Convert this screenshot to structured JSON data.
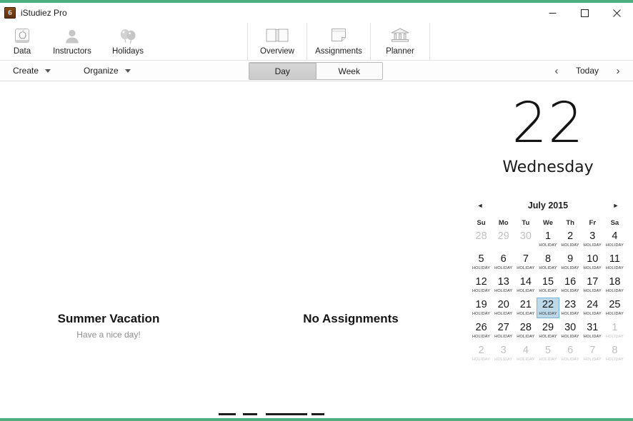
{
  "window": {
    "title": "iStudiez Pro",
    "app_icon": "istudiez-app-icon",
    "accent_color": "#4caf7d",
    "controls": {
      "minimize": "minimize-icon",
      "maximize": "maximize-icon",
      "close": "close-icon"
    }
  },
  "ribbon": {
    "left_group": [
      {
        "label": "Data",
        "icon": "database-apple-icon"
      },
      {
        "label": "Instructors",
        "icon": "person-icon"
      },
      {
        "label": "Holidays",
        "icon": "balloons-icon"
      }
    ],
    "center_group": [
      {
        "label": "Overview",
        "icon": "open-book-icon"
      },
      {
        "label": "Assignments",
        "icon": "note-page-icon"
      },
      {
        "label": "Planner",
        "icon": "bank-columns-icon"
      }
    ]
  },
  "subbar": {
    "menus": [
      {
        "label": "Create",
        "icon": "chevron-down-icon"
      },
      {
        "label": "Organize",
        "icon": "chevron-down-icon"
      }
    ],
    "view_toggle": {
      "options": [
        "Day",
        "Week"
      ],
      "selected": "Day"
    },
    "navigation": {
      "prev": "‹",
      "today_label": "Today",
      "next": "›"
    }
  },
  "main": {
    "holiday_panel": {
      "title": "Summer Vacation",
      "subtitle": "Have a nice day!"
    },
    "assignments_panel": {
      "title": "No Assignments"
    }
  },
  "date_panel": {
    "day_number": "22",
    "day_name": "Wednesday"
  },
  "mini_calendar": {
    "month_label": "July 2015",
    "prev_icon": "◄",
    "next_icon": "►",
    "weekdays": [
      "Su",
      "Mo",
      "Tu",
      "We",
      "Th",
      "Fr",
      "Sa"
    ],
    "holiday_label": "HOLIDAY",
    "selected_day": 22,
    "selected_color": "#bcd9ea",
    "weeks": [
      [
        {
          "n": "28",
          "out": true,
          "holiday": false
        },
        {
          "n": "29",
          "out": true,
          "holiday": false
        },
        {
          "n": "30",
          "out": true,
          "holiday": false
        },
        {
          "n": "1",
          "out": false,
          "holiday": true
        },
        {
          "n": "2",
          "out": false,
          "holiday": true
        },
        {
          "n": "3",
          "out": false,
          "holiday": true
        },
        {
          "n": "4",
          "out": false,
          "holiday": true
        }
      ],
      [
        {
          "n": "5",
          "out": false,
          "holiday": true
        },
        {
          "n": "6",
          "out": false,
          "holiday": true
        },
        {
          "n": "7",
          "out": false,
          "holiday": true
        },
        {
          "n": "8",
          "out": false,
          "holiday": true
        },
        {
          "n": "9",
          "out": false,
          "holiday": true
        },
        {
          "n": "10",
          "out": false,
          "holiday": true
        },
        {
          "n": "11",
          "out": false,
          "holiday": true
        }
      ],
      [
        {
          "n": "12",
          "out": false,
          "holiday": true
        },
        {
          "n": "13",
          "out": false,
          "holiday": true
        },
        {
          "n": "14",
          "out": false,
          "holiday": true
        },
        {
          "n": "15",
          "out": false,
          "holiday": true
        },
        {
          "n": "16",
          "out": false,
          "holiday": true
        },
        {
          "n": "17",
          "out": false,
          "holiday": true
        },
        {
          "n": "18",
          "out": false,
          "holiday": true
        }
      ],
      [
        {
          "n": "19",
          "out": false,
          "holiday": true
        },
        {
          "n": "20",
          "out": false,
          "holiday": true
        },
        {
          "n": "21",
          "out": false,
          "holiday": true
        },
        {
          "n": "22",
          "out": false,
          "holiday": true,
          "selected": true
        },
        {
          "n": "23",
          "out": false,
          "holiday": true
        },
        {
          "n": "24",
          "out": false,
          "holiday": true
        },
        {
          "n": "25",
          "out": false,
          "holiday": true
        }
      ],
      [
        {
          "n": "26",
          "out": false,
          "holiday": true
        },
        {
          "n": "27",
          "out": false,
          "holiday": true
        },
        {
          "n": "28",
          "out": false,
          "holiday": true
        },
        {
          "n": "29",
          "out": false,
          "holiday": true
        },
        {
          "n": "30",
          "out": false,
          "holiday": true
        },
        {
          "n": "31",
          "out": false,
          "holiday": true
        },
        {
          "n": "1",
          "out": true,
          "holiday": true
        }
      ],
      [
        {
          "n": "2",
          "out": true,
          "holiday": true
        },
        {
          "n": "3",
          "out": true,
          "holiday": true
        },
        {
          "n": "4",
          "out": true,
          "holiday": true
        },
        {
          "n": "5",
          "out": true,
          "holiday": true
        },
        {
          "n": "6",
          "out": true,
          "holiday": true
        },
        {
          "n": "7",
          "out": true,
          "holiday": true
        },
        {
          "n": "8",
          "out": true,
          "holiday": true
        }
      ]
    ]
  }
}
